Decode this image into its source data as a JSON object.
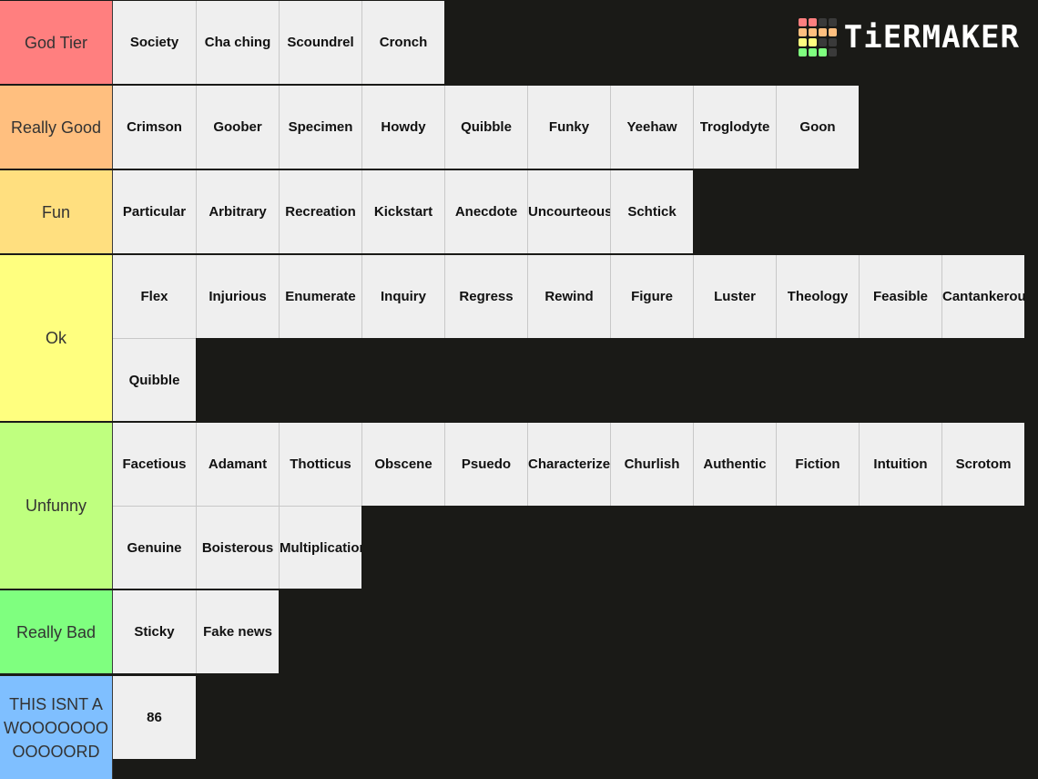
{
  "brand": {
    "name": "TiERMAKER",
    "logo_colors": [
      [
        "#ff7f7f",
        "#ff7f7f",
        "#3a3a3a",
        "#3a3a3a"
      ],
      [
        "#ffbf7f",
        "#ffbf7f",
        "#ffbf7f",
        "#ffbf7f"
      ],
      [
        "#ffff7f",
        "#ffff7f",
        "#3a3a3a",
        "#3a3a3a"
      ],
      [
        "#7fff7f",
        "#7fff7f",
        "#7fff7f",
        "#3a3a3a"
      ]
    ]
  },
  "tiers": [
    {
      "label": "God Tier",
      "color": "#ff7f7f",
      "items": [
        "Society",
        "Cha ching",
        "Scoundrel",
        "Cronch"
      ]
    },
    {
      "label": "Really Good",
      "color": "#ffbf7f",
      "items": [
        "Crimson",
        "Goober",
        "Specimen",
        "Howdy",
        "Quibble",
        "Funky",
        "Yeehaw",
        "Troglodyte",
        "Goon"
      ]
    },
    {
      "label": "Fun",
      "color": "#ffdf7f",
      "items": [
        "Particular",
        "Arbitrary",
        "Recreation",
        "Kickstart",
        "Anecdote",
        "Uncourteous",
        "Schtick"
      ]
    },
    {
      "label": "Ok",
      "color": "#ffff7f",
      "items": [
        "Flex",
        "Injurious",
        "Enumerate",
        "Inquiry",
        "Regress",
        "Rewind",
        "Figure",
        "Luster",
        "Theology",
        "Feasible",
        "Cantankerous",
        "Quibble"
      ]
    },
    {
      "label": "Unfunny",
      "color": "#bfff7f",
      "items": [
        "Facetious",
        "Adamant",
        "Thotticus",
        "Obscene",
        "Psuedo",
        "Characterize",
        "Churlish",
        "Authentic",
        "Fiction",
        "Intuition",
        "Scrotom",
        "Genuine",
        "Boisterous",
        "Multiplication"
      ]
    },
    {
      "label": "Really Bad",
      "color": "#7fff7f",
      "items": [
        "Sticky",
        "Fake news"
      ]
    },
    {
      "label": "THIS ISNT A WOOOOOOOOOOOORD",
      "color": "#7fbfff",
      "items": [
        "86"
      ]
    }
  ]
}
